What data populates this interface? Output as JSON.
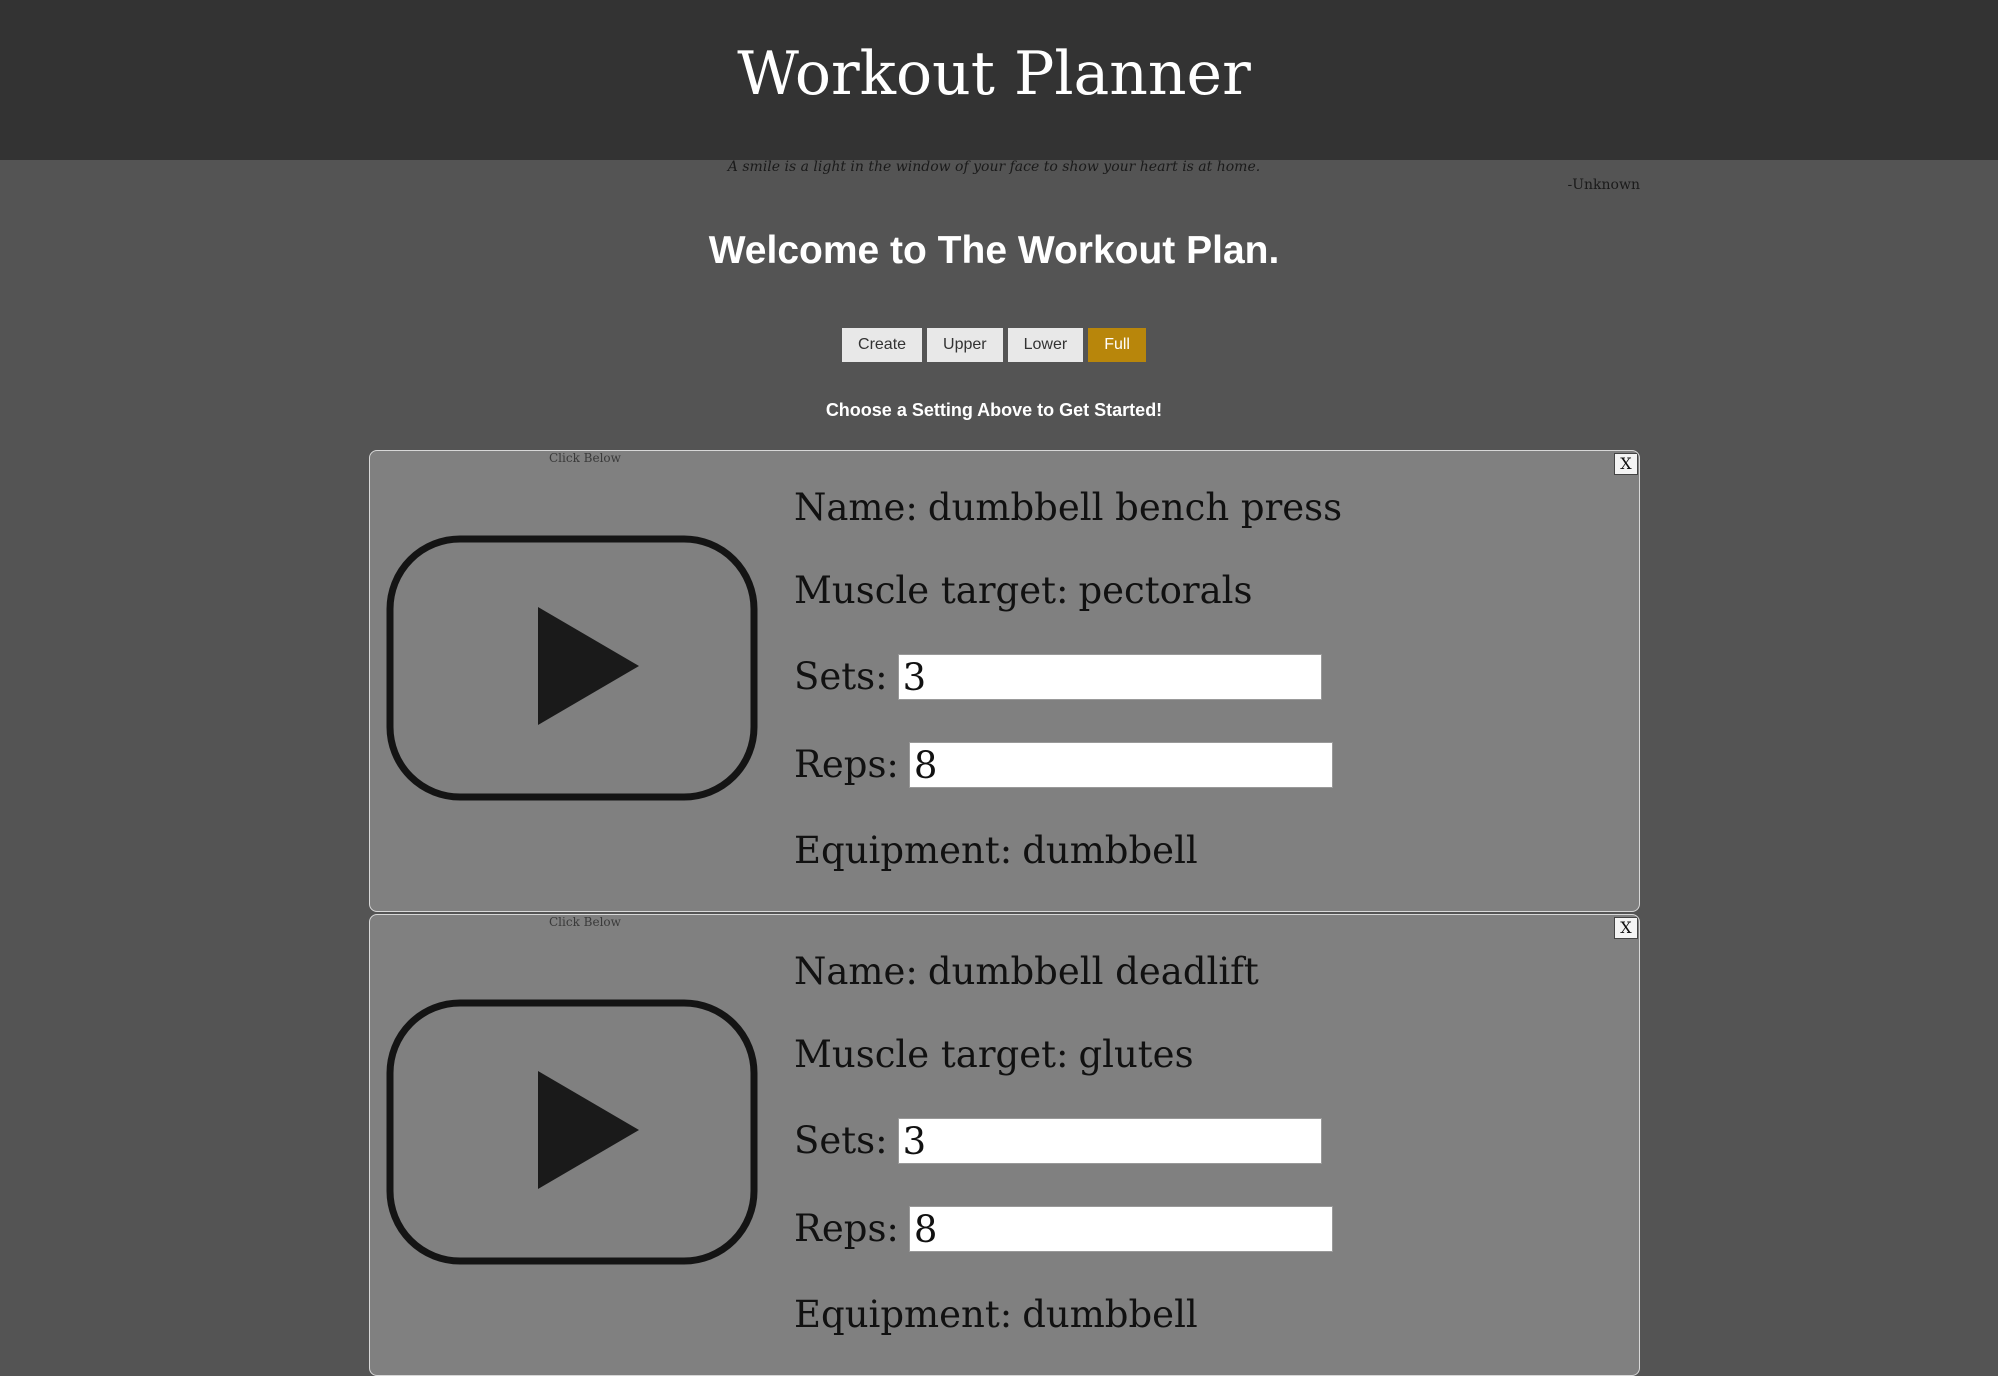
{
  "header": {
    "title": "Workout Planner"
  },
  "quote": {
    "text": "A smile is a light in the window of your face to show your heart is at home.",
    "author": "-Unknown"
  },
  "welcome": "Welcome to The Workout Plan.",
  "mode_buttons": [
    {
      "label": "Create",
      "active": false
    },
    {
      "label": "Upper",
      "active": false
    },
    {
      "label": "Lower",
      "active": false
    },
    {
      "label": "Full",
      "active": true
    }
  ],
  "instructions": "Choose a Setting Above to Get Started!",
  "colors": {
    "header_bg": "#333333",
    "page_bg": "#545454",
    "card_bg": "#808080",
    "active_button": "#b8860b"
  },
  "exercises": [
    {
      "caption": "Click Below",
      "close_label": "X",
      "video_icon": "play-video-icon",
      "name_label": "Name:",
      "name": "dumbbell bench press",
      "muscle_label": "Muscle target:",
      "muscle": "pectorals",
      "sets_label": "Sets:",
      "sets": "3",
      "reps_label": "Reps:",
      "reps": "8",
      "equipment_label": "Equipment:",
      "equipment": "dumbbell"
    },
    {
      "caption": "Click Below",
      "close_label": "X",
      "video_icon": "play-video-icon",
      "name_label": "Name:",
      "name": "dumbbell deadlift",
      "muscle_label": "Muscle target:",
      "muscle": "glutes",
      "sets_label": "Sets:",
      "sets": "3",
      "reps_label": "Reps:",
      "reps": "8",
      "equipment_label": "Equipment:",
      "equipment": "dumbbell"
    }
  ]
}
